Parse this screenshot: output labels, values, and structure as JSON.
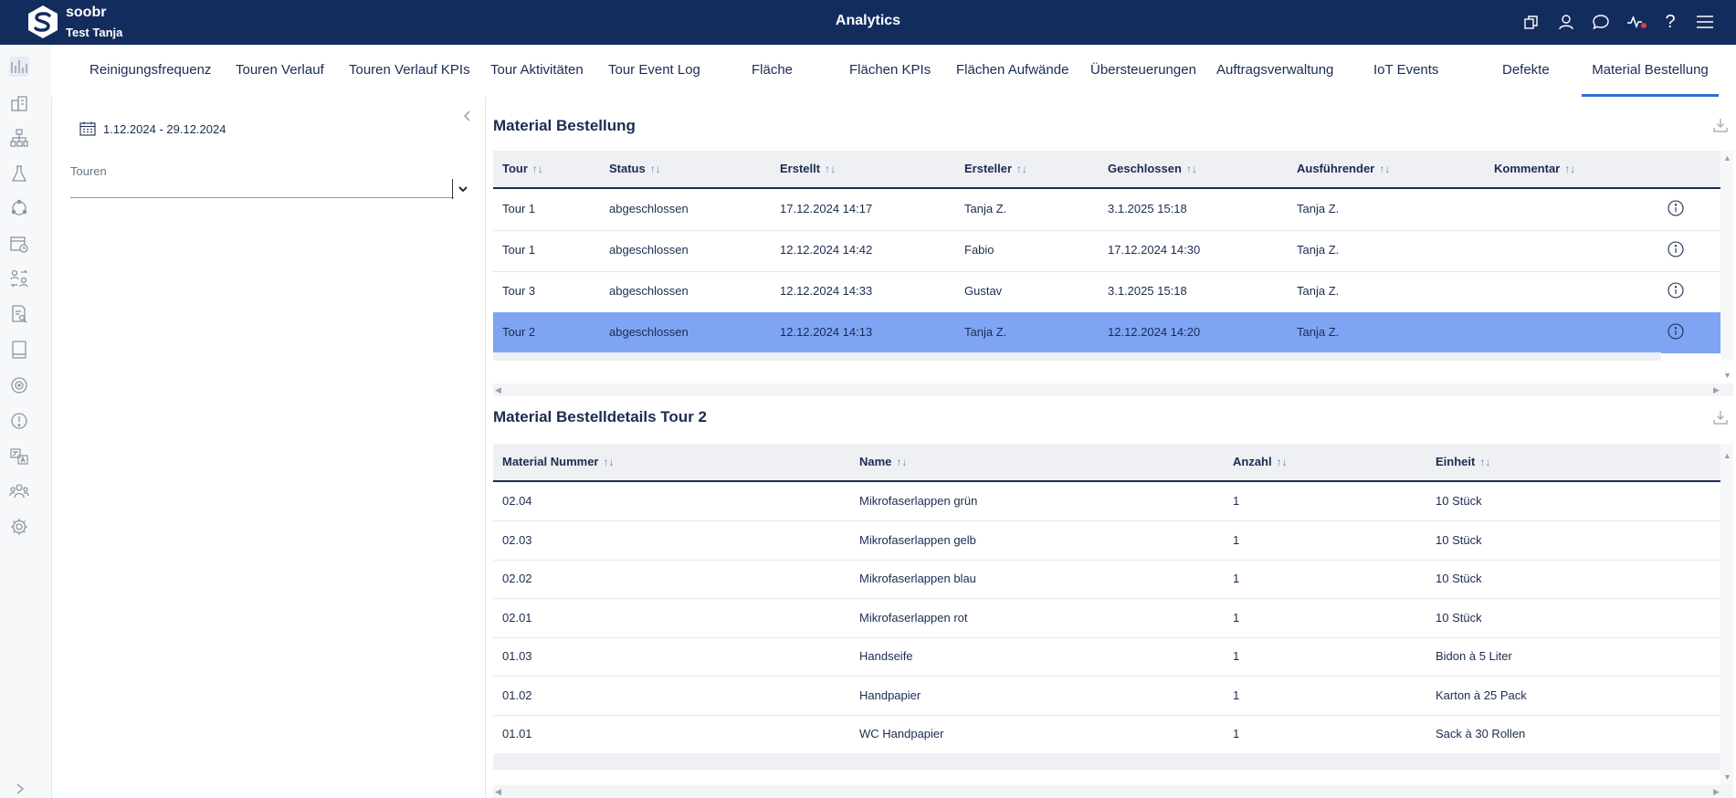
{
  "header": {
    "brand": "soobr",
    "user": "Test Tanja",
    "title": "Analytics",
    "icons": [
      "copy-icon",
      "user-icon",
      "chat-icon",
      "activity-icon",
      "help-icon",
      "menu-icon"
    ],
    "help_label": "?"
  },
  "colors": {
    "topbar": "#132c5e",
    "accent": "#2c6fd6",
    "selected_row": "#7ea4f3",
    "notification": "#e23a4a"
  },
  "sidebar_icons": [
    "chart-bars-icon",
    "building-icon",
    "hierarchy-icon",
    "flask-icon",
    "cycle-icon",
    "calendar-clock-icon",
    "swap-people-icon",
    "document-search-icon",
    "tablet-icon",
    "target-icon",
    "alert-icon",
    "translate-icon",
    "team-icon",
    "settings-icon"
  ],
  "tabs": [
    {
      "label": "Reinigungsfrequenz"
    },
    {
      "label": "Touren Verlauf"
    },
    {
      "label": "Touren Verlauf KPIs"
    },
    {
      "label": "Tour Aktivitäten"
    },
    {
      "label": "Tour Event Log"
    },
    {
      "label": "Fläche"
    },
    {
      "label": "Flächen KPIs"
    },
    {
      "label": "Flächen Aufwände"
    },
    {
      "label": "Übersteuerungen"
    },
    {
      "label": "Auftragsverwaltung"
    },
    {
      "label": "IoT Events"
    },
    {
      "label": "Defekte"
    },
    {
      "label": "Material Bestellung"
    }
  ],
  "active_tab": "Material Bestellung",
  "filters": {
    "date_range": "1.12.2024 - 29.12.2024",
    "tours_label": "Touren",
    "tours_value": ""
  },
  "orders": {
    "title": "Material Bestellung",
    "columns": [
      "Tour",
      "Status",
      "Erstellt",
      "Ersteller",
      "Geschlossen",
      "Ausführender",
      "Kommentar"
    ],
    "rows": [
      {
        "tour": "Tour 1",
        "status": "abgeschlossen",
        "created": "17.12.2024 14:17",
        "creator": "Tanja Z.",
        "closed": "3.1.2025 15:18",
        "executor": "Tanja Z.",
        "comment": ""
      },
      {
        "tour": "Tour 1",
        "status": "abgeschlossen",
        "created": "12.12.2024 14:42",
        "creator": "Fabio",
        "closed": "17.12.2024 14:30",
        "executor": "Tanja Z.",
        "comment": ""
      },
      {
        "tour": "Tour 3",
        "status": "abgeschlossen",
        "created": "12.12.2024 14:33",
        "creator": "Gustav",
        "closed": "3.1.2025 15:18",
        "executor": "Tanja Z.",
        "comment": ""
      },
      {
        "tour": "Tour 2",
        "status": "abgeschlossen",
        "created": "12.12.2024 14:13",
        "creator": "Tanja Z.",
        "closed": "12.12.2024 14:20",
        "executor": "Tanja Z.",
        "comment": ""
      }
    ],
    "selected_row": 3
  },
  "details": {
    "title": "Material Bestelldetails Tour 2",
    "columns": [
      "Material Nummer",
      "Name",
      "Anzahl",
      "Einheit"
    ],
    "rows": [
      {
        "number": "02.04",
        "name": "Mikrofaserlappen grün",
        "qty": "1",
        "unit": "10 Stück"
      },
      {
        "number": "02.03",
        "name": "Mikrofaserlappen gelb",
        "qty": "1",
        "unit": "10 Stück"
      },
      {
        "number": "02.02",
        "name": "Mikrofaserlappen blau",
        "qty": "1",
        "unit": "10 Stück"
      },
      {
        "number": "02.01",
        "name": "Mikrofaserlappen rot",
        "qty": "1",
        "unit": "10 Stück"
      },
      {
        "number": "01.03",
        "name": "Handseife",
        "qty": "1",
        "unit": "Bidon à 5 Liter"
      },
      {
        "number": "01.02",
        "name": "Handpapier",
        "qty": "1",
        "unit": "Karton à 25 Pack"
      },
      {
        "number": "01.01",
        "name": "WC Handpapier",
        "qty": "1",
        "unit": "Sack à 30 Rollen"
      }
    ]
  },
  "sort_glyph": "↑↓"
}
